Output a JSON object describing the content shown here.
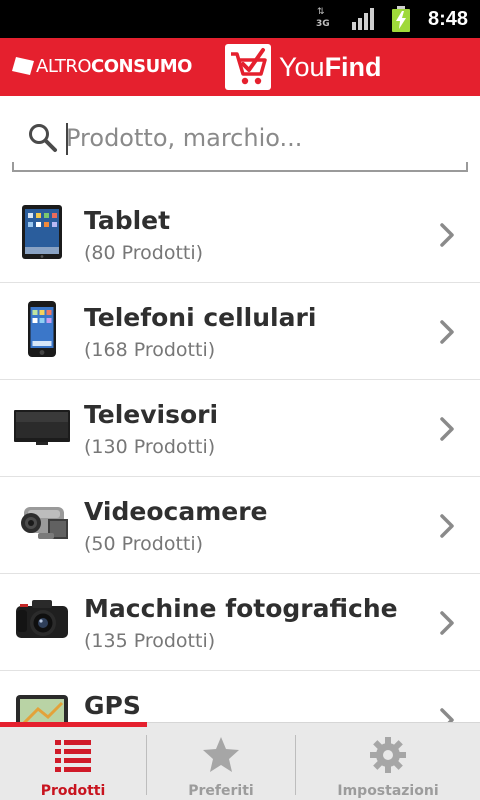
{
  "status_bar": {
    "network_type": "3G",
    "time": "8:48",
    "signal_icon": "signal-bars-icon",
    "battery_icon": "battery-charging-icon"
  },
  "header": {
    "left_brand_prefix": "ALTRO",
    "left_brand_suffix": "CONSUMO",
    "app_name_prefix": "You",
    "app_name_suffix": "Find",
    "brand_color": "#e5202e"
  },
  "search": {
    "placeholder": "Prodotto, marchio...",
    "value": "",
    "icon": "search-icon"
  },
  "categories": [
    {
      "title": "Tablet",
      "count": "(80 Prodotti)",
      "icon": "tablet-icon"
    },
    {
      "title": "Telefoni cellulari",
      "count": "(168 Prodotti)",
      "icon": "phone-icon"
    },
    {
      "title": "Televisori",
      "count": "(130 Prodotti)",
      "icon": "tv-icon"
    },
    {
      "title": "Videocamere",
      "count": "(50 Prodotti)",
      "icon": "camcorder-icon"
    },
    {
      "title": "Macchine fotografiche",
      "count": "(135 Prodotti)",
      "icon": "camera-icon"
    },
    {
      "title": "GPS",
      "count": "",
      "icon": "gps-icon"
    }
  ],
  "tabs": [
    {
      "label": "Prodotti",
      "icon": "list-icon",
      "active": true
    },
    {
      "label": "Preferiti",
      "icon": "star-icon",
      "active": false
    },
    {
      "label": "Impostazioni",
      "icon": "gear-icon",
      "active": false
    }
  ],
  "colors": {
    "accent": "#e5202e",
    "active_tab_text": "#c8141f",
    "inactive_tab_text": "#9c9c9c"
  }
}
